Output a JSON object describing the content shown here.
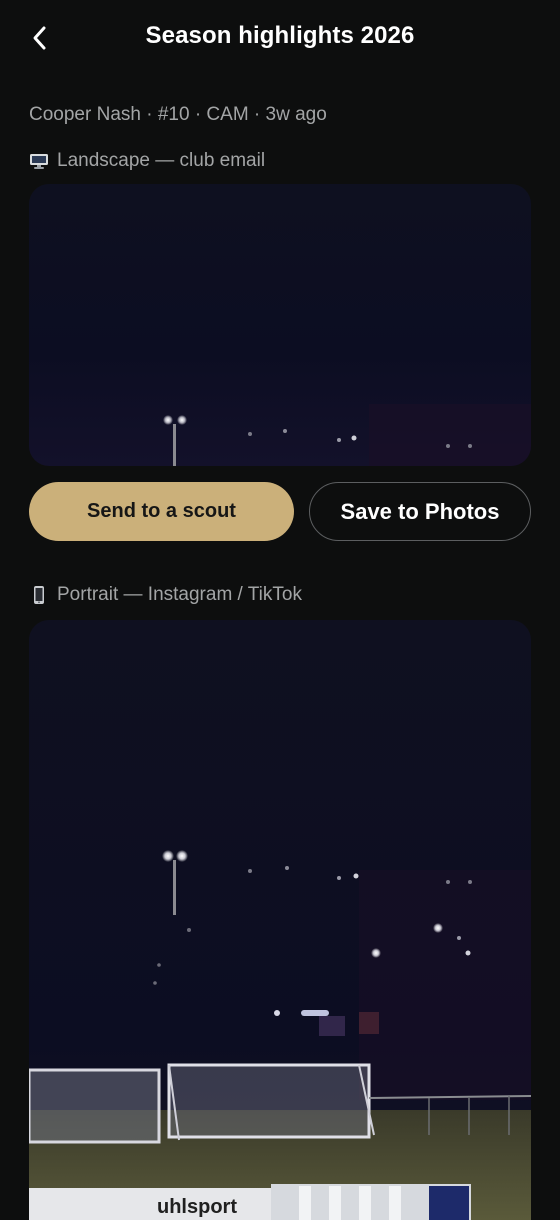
{
  "header": {
    "title": "Season highlights 2026",
    "back_icon": "chevron-left-icon"
  },
  "meta": {
    "text": "Cooper Nash · #10 · CAM · 3w ago"
  },
  "landscape": {
    "icon": "monitor-icon",
    "label": "Landscape — club email"
  },
  "actions": {
    "send_label": "Send to a scout",
    "save_label": "Save to Photos"
  },
  "portrait": {
    "icon": "phone-icon",
    "label": "Portrait — Instagram / TikTok",
    "board_text": "uhlsport"
  },
  "colors": {
    "background": "#0d0e0e",
    "accent": "#cbb07a",
    "muted_text": "#a3a5a6"
  }
}
